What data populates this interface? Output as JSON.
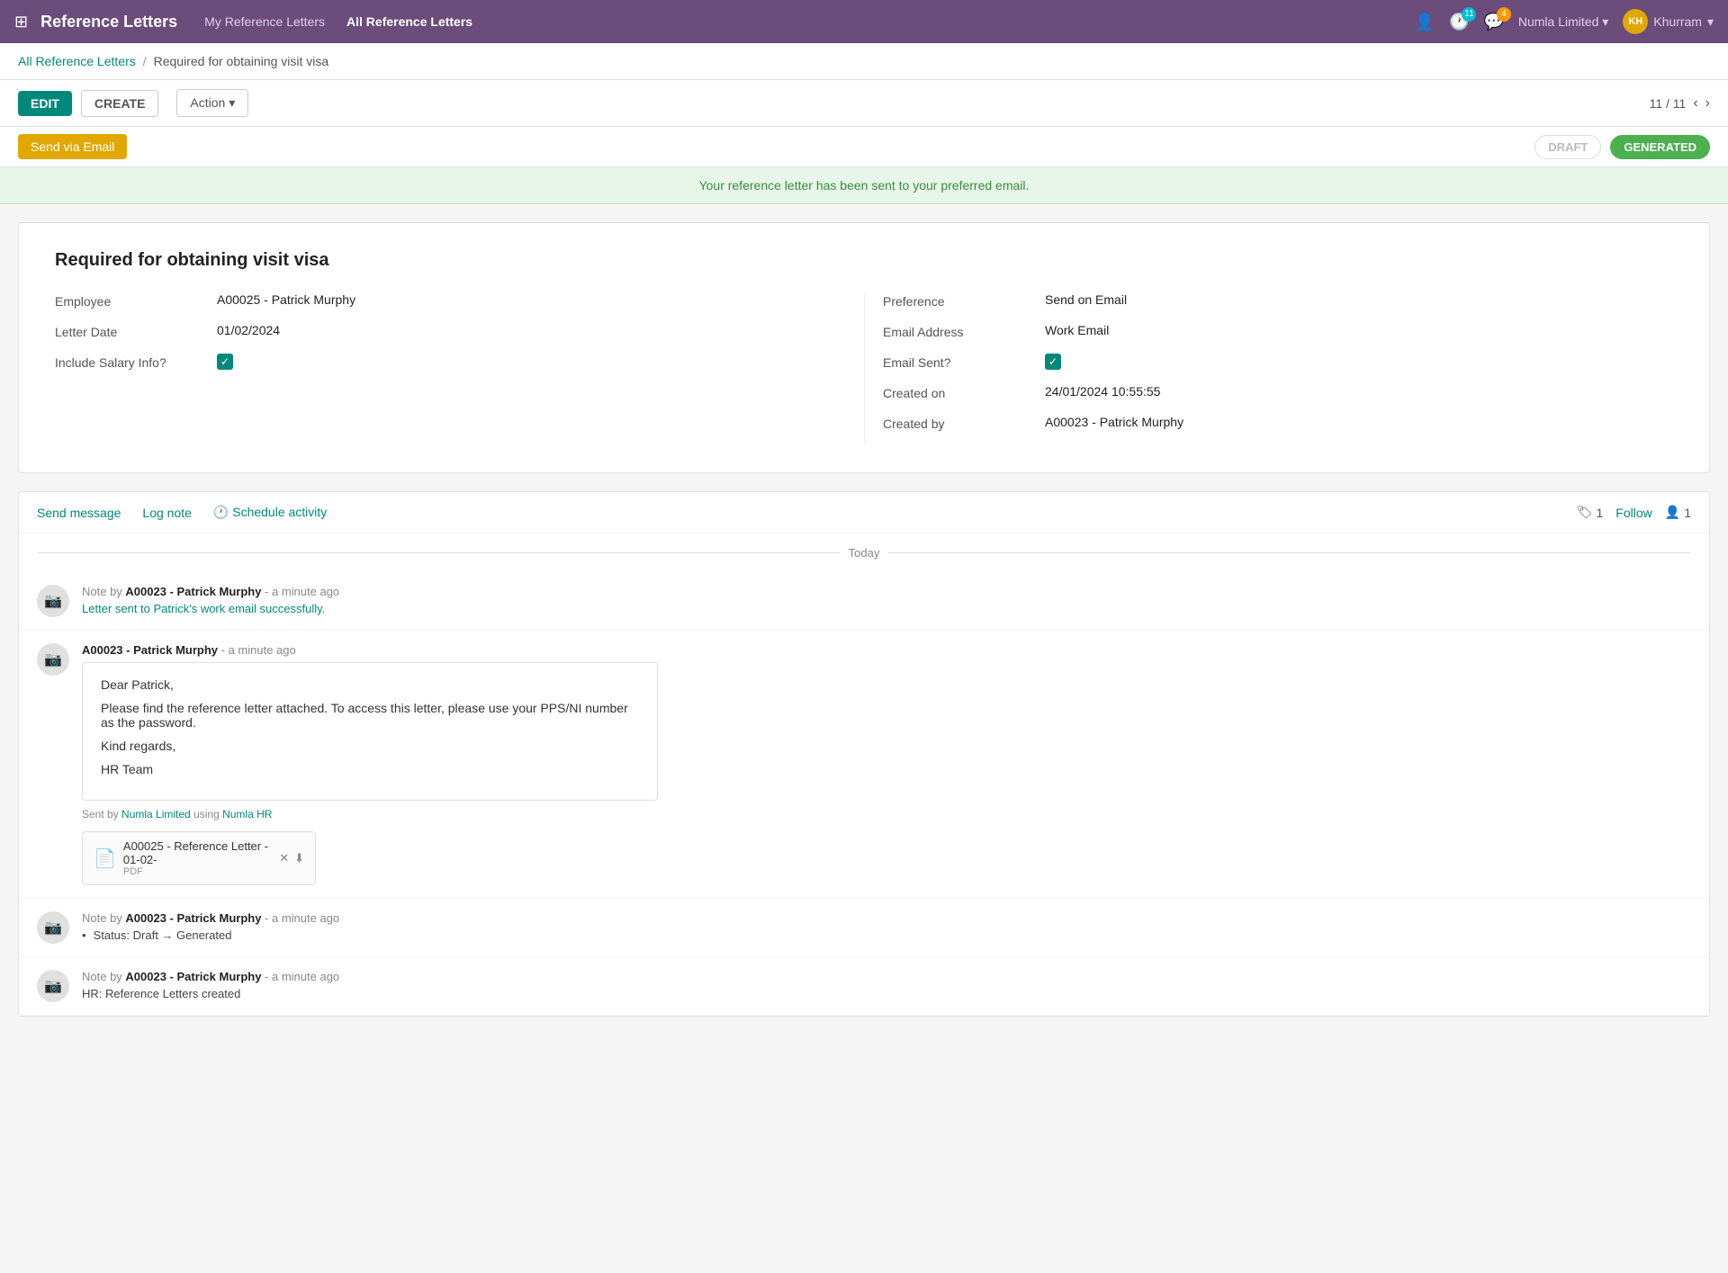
{
  "nav": {
    "app_title": "Reference Letters",
    "links": [
      {
        "label": "My Reference Letters",
        "active": false
      },
      {
        "label": "All Reference Letters",
        "active": true
      }
    ],
    "notifications": [
      {
        "icon": "clock-icon",
        "count": "11",
        "badge_color": "teal"
      },
      {
        "icon": "chat-icon",
        "count": "4",
        "badge_color": "orange"
      }
    ],
    "company": "Numla Limited",
    "user": "Khurram",
    "user_initials": "KH"
  },
  "breadcrumb": {
    "parent": "All Reference Letters",
    "current": "Required for obtaining visit visa"
  },
  "toolbar": {
    "edit_label": "EDIT",
    "create_label": "CREATE",
    "action_label": "Action",
    "pagination": "11 / 11"
  },
  "status_bar": {
    "send_email_label": "Send via Email",
    "statuses": [
      {
        "label": "DRAFT",
        "active": false
      },
      {
        "label": "GENERATED",
        "active": true
      }
    ]
  },
  "success_banner": {
    "message": "Your reference letter has been sent to your preferred email."
  },
  "form": {
    "title": "Required for obtaining visit visa",
    "left_fields": [
      {
        "label": "Employee",
        "value": "A00025 - Patrick Murphy"
      },
      {
        "label": "Letter Date",
        "value": "01/02/2024"
      },
      {
        "label": "Include Salary Info?",
        "value": "checkbox_checked"
      }
    ],
    "right_fields": [
      {
        "label": "Preference",
        "value": "Send on Email"
      },
      {
        "label": "Email Address",
        "value": "Work Email"
      },
      {
        "label": "Email Sent?",
        "value": "checkbox_checked"
      },
      {
        "label": "Created on",
        "value": "24/01/2024 10:55:55"
      },
      {
        "label": "Created by",
        "value": "A00023 - Patrick Murphy"
      }
    ]
  },
  "chatter": {
    "actions": [
      {
        "label": "Send message",
        "icon": ""
      },
      {
        "label": "Log note",
        "icon": ""
      },
      {
        "label": "Schedule activity",
        "icon": "clock"
      }
    ],
    "follow_count": "1",
    "follower_count": "1",
    "date_divider": "Today",
    "messages": [
      {
        "type": "note",
        "author": "A00023 - Patrick Murphy",
        "time": "a minute ago",
        "is_note": true,
        "text": "Letter sent to Patrick's work email successfully."
      },
      {
        "type": "email",
        "author": "A00023 - Patrick Murphy",
        "time": "a minute ago",
        "is_note": false,
        "email_lines": [
          "Dear Patrick,",
          "Please find the reference letter attached. To access this letter, please use your PPS/NI number as the password.",
          "Kind regards,",
          "HR Team"
        ],
        "sent_by": "Sent by Numla Limited using Numla HR",
        "attachment_name": "A00025 - Reference Letter - 01-02-",
        "attachment_ext": "PDF"
      },
      {
        "type": "note",
        "author": "A00023 - Patrick Murphy",
        "time": "a minute ago",
        "is_note": true,
        "bullet": "Status: Draft → Generated"
      },
      {
        "type": "note",
        "author": "A00023 - Patrick Murphy",
        "time": "a minute ago",
        "is_note": true,
        "text": "HR: Reference Letters created"
      }
    ]
  }
}
